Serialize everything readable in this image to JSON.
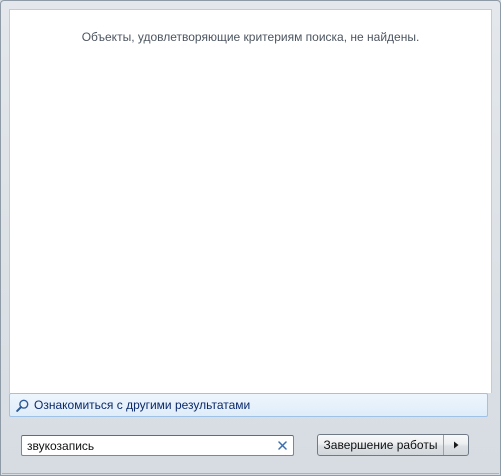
{
  "results": {
    "empty_message": "Объекты, удовлетворяющие критериям поиска, не найдены."
  },
  "see_more": {
    "icon": "magnifier-icon",
    "label": "Ознакомиться с другими результатами"
  },
  "search": {
    "value": "звукозапись",
    "clear_icon": "close-icon"
  },
  "shutdown": {
    "label": "Завершение работы",
    "arrow_icon": "triangle-right-icon"
  },
  "colors": {
    "link_text": "#0b2a6b",
    "clear_icon": "#3a6fb0",
    "panel_bg": "#ffffff"
  }
}
